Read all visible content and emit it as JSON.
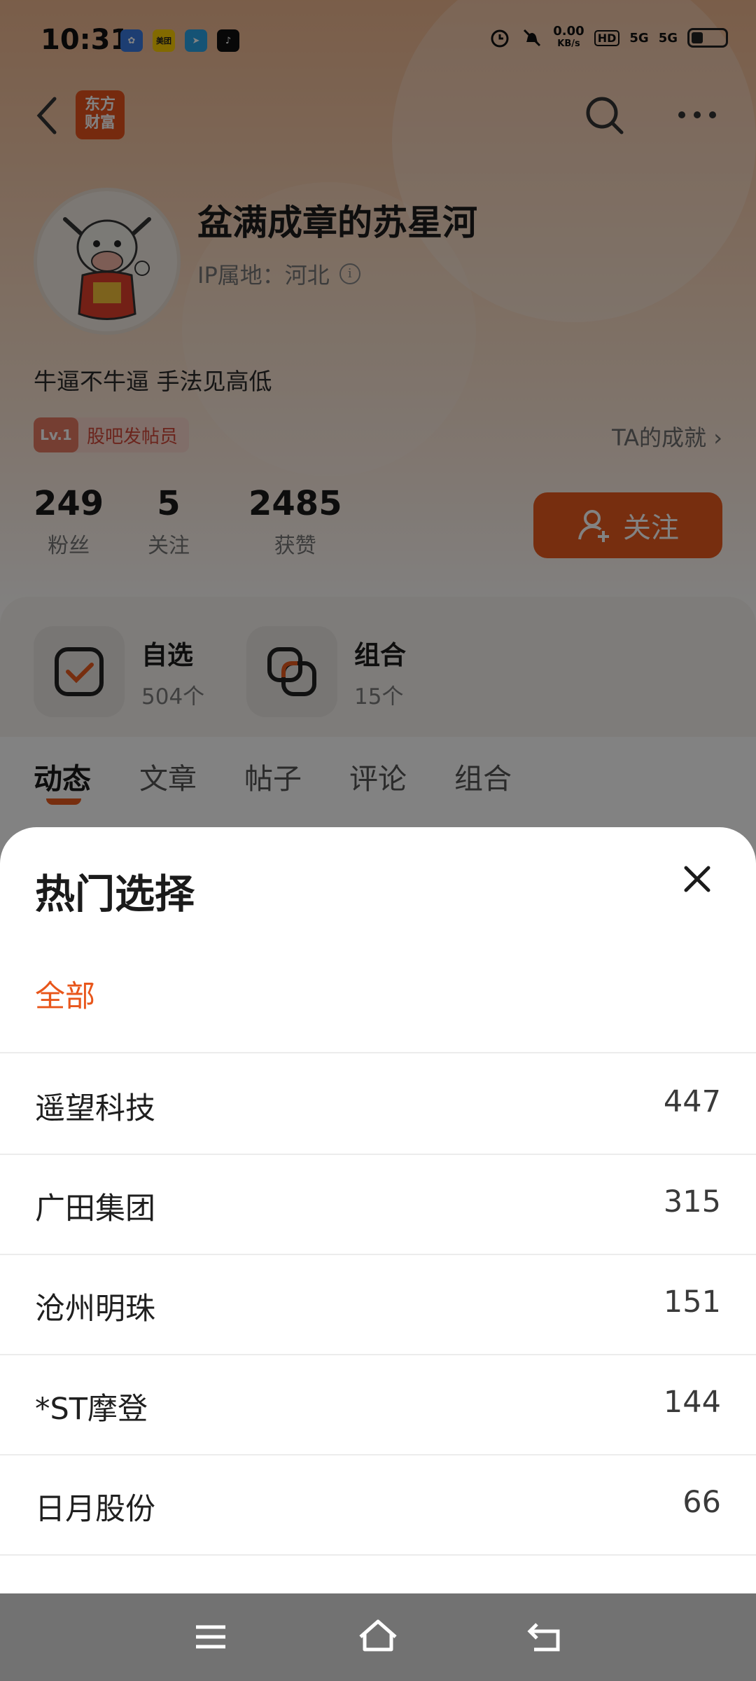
{
  "status_bar": {
    "time": "10:31",
    "net_speed_value": "0.00",
    "net_speed_unit": "KB/s",
    "hd_label": "HD",
    "signal_1": "5G",
    "signal_2": "5G",
    "notif_meituan": "美团"
  },
  "navbar": {
    "logo_line1": "东方",
    "logo_line2": "财富"
  },
  "profile": {
    "username": "盆满成章的苏星河",
    "ip_location": "IP属地：河北",
    "bio": "牛逼不牛逼 手法见高低",
    "badge_level": "Lv.1",
    "badge_text": "股吧发帖员",
    "achievements": "TA的成就",
    "stats": {
      "fans_count": "249",
      "fans_label": "粉丝",
      "following_count": "5",
      "following_label": "关注",
      "likes_count": "2485",
      "likes_label": "获赞"
    },
    "follow_button": "关注"
  },
  "cards": {
    "watchlist_title": "自选",
    "watchlist_count": "504个",
    "portfolio_title": "组合",
    "portfolio_count": "15个"
  },
  "tabs": [
    "动态",
    "文章",
    "帖子",
    "评论",
    "组合"
  ],
  "sheet": {
    "title": "热门选择",
    "all_label": "全部",
    "items": [
      {
        "name": "遥望科技",
        "count": "447"
      },
      {
        "name": "广田集团",
        "count": "315"
      },
      {
        "name": "沧州明珠",
        "count": "151"
      },
      {
        "name": "*ST摩登",
        "count": "144"
      },
      {
        "name": "日月股份",
        "count": "66"
      }
    ]
  },
  "colors": {
    "accent": "#e95b1e",
    "selected_text": "#e8561b"
  }
}
